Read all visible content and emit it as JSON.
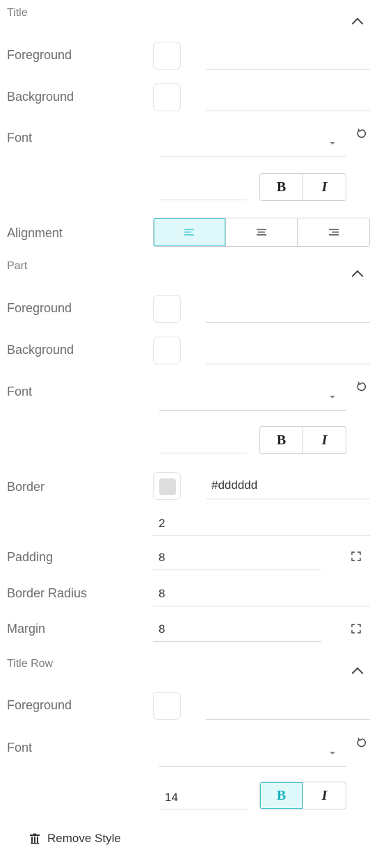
{
  "title_section": {
    "heading": "Title",
    "foreground_label": "Foreground",
    "background_label": "Background",
    "font_label": "Font",
    "font_size": "",
    "bold_label": "B",
    "italic_label": "I",
    "alignment_label": "Alignment"
  },
  "part_section": {
    "heading": "Part",
    "foreground_label": "Foreground",
    "background_label": "Background",
    "font_label": "Font",
    "font_size": "",
    "bold_label": "B",
    "italic_label": "I",
    "border_label": "Border",
    "border_color": "#dddddd",
    "border_width": "2",
    "padding_label": "Padding",
    "padding_value": "8",
    "border_radius_label": "Border Radius",
    "border_radius_value": "8",
    "margin_label": "Margin",
    "margin_value": "8"
  },
  "title_row_section": {
    "heading": "Title Row",
    "foreground_label": "Foreground",
    "font_label": "Font",
    "font_size": "14",
    "bold_label": "B",
    "italic_label": "I"
  },
  "remove_style_label": "Remove Style",
  "colors": {
    "accent": "#3fc7cf",
    "accent_bg": "#dff8fa",
    "border_swatch": "#dddddd"
  }
}
